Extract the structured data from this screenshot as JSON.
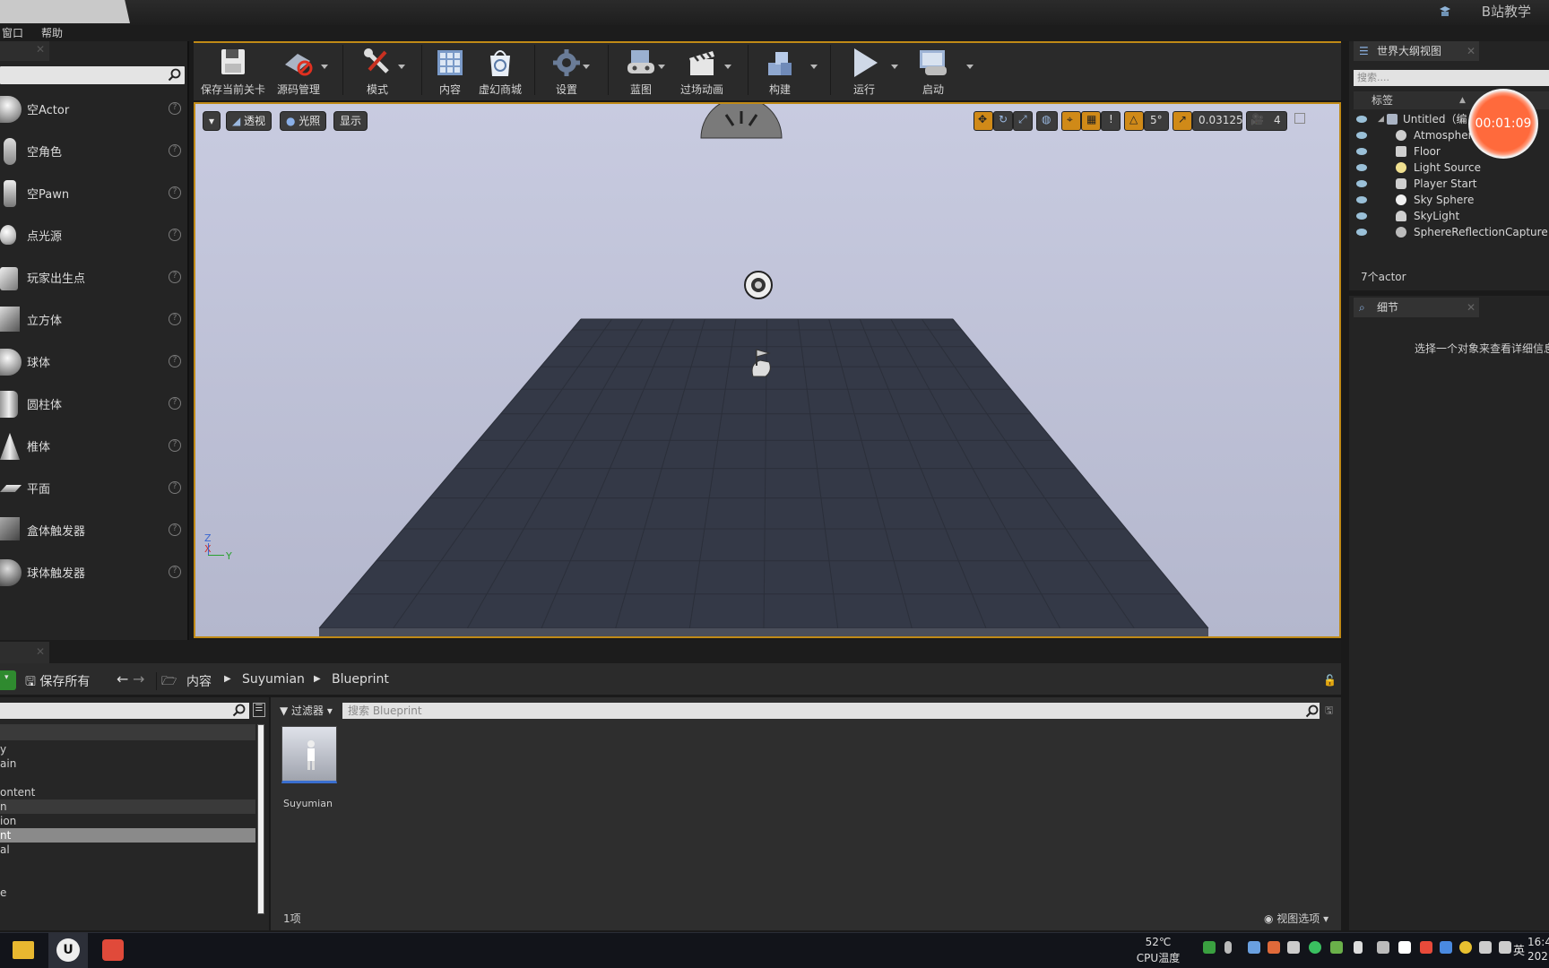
{
  "title": {
    "brand": "B站教学"
  },
  "menu": {
    "items": [
      "窗口",
      "帮助"
    ]
  },
  "place_panel": {
    "items": [
      {
        "label": "空Actor"
      },
      {
        "label": "空角色"
      },
      {
        "label": "空Pawn"
      },
      {
        "label": "点光源"
      },
      {
        "label": "玩家出生点"
      },
      {
        "label": "立方体"
      },
      {
        "label": "球体"
      },
      {
        "label": "圆柱体"
      },
      {
        "label": "椎体"
      },
      {
        "label": "平面"
      },
      {
        "label": "盒体触发器"
      },
      {
        "label": "球体触发器"
      }
    ],
    "help_glyph": "?"
  },
  "toolbar": {
    "buttons": [
      {
        "label": "保存当前关卡"
      },
      {
        "label": "源码管理"
      },
      {
        "label": "模式"
      },
      {
        "label": "内容"
      },
      {
        "label": "虚幻商城"
      },
      {
        "label": "设置"
      },
      {
        "label": "蓝图"
      },
      {
        "label": "过场动画"
      },
      {
        "label": "构建"
      },
      {
        "label": "运行"
      },
      {
        "label": "启动"
      }
    ]
  },
  "viewport": {
    "perspective": "透视",
    "lit": "光照",
    "show": "显示",
    "snap_angle": "5°",
    "scale_snap": "0.03125",
    "camera_speed": "4",
    "axis_x": "X",
    "axis_y": "Y",
    "axis_z": "Z"
  },
  "outliner": {
    "tab": "世界大纲视图",
    "search_placeholder": "搜索....",
    "column": "标签",
    "items": [
      {
        "label": "Untitled（编"
      },
      {
        "label": "Atmospher"
      },
      {
        "label": "Floor"
      },
      {
        "label": "Light Source"
      },
      {
        "label": "Player Start"
      },
      {
        "label": "Sky Sphere"
      },
      {
        "label": "SkyLight"
      },
      {
        "label": "SphereReflectionCapture"
      }
    ],
    "count": "7个actor"
  },
  "details": {
    "tab": "细节",
    "empty_text": "选择一个对象来查看详细信息"
  },
  "recorder": {
    "time": "00:01:09"
  },
  "content_browser": {
    "save_all": "保存所有",
    "path": [
      "内容",
      "Suyumian",
      "Blueprint"
    ],
    "filter": "过滤器",
    "search_placeholder": "搜索 Blueprint",
    "asset_name": "Suyumian",
    "item_count": "1项",
    "view_options": "视图选项",
    "tree_fragments": [
      "y",
      "ain",
      "ontent",
      "n",
      "ion",
      "nt",
      "al",
      "e"
    ]
  },
  "taskbar": {
    "temp": "52℃",
    "temp_label": "CPU温度",
    "ime": "英",
    "time": "16:4",
    "date": "202"
  },
  "colors": {
    "accent": "#c08a16",
    "timer": "#ff6a3c",
    "panel": "#242424"
  }
}
